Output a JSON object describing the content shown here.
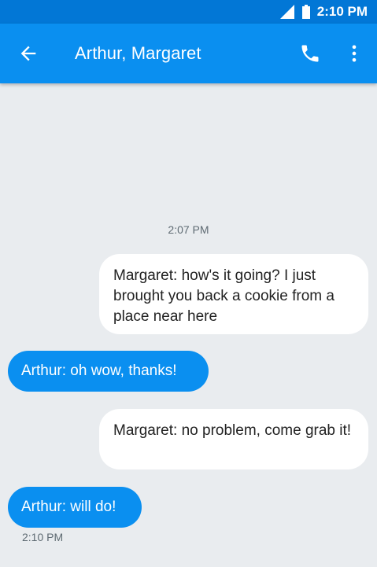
{
  "status_bar": {
    "time": "2:10 PM",
    "icons": [
      "signal-icon",
      "battery-icon"
    ]
  },
  "app_bar": {
    "title": "Arthur, Margaret",
    "icons": [
      "back-arrow-icon",
      "phone-icon",
      "more-vert-icon"
    ]
  },
  "conversation": {
    "start_timestamp": "2:07 PM",
    "messages": [
      {
        "direction": "outgoing",
        "text": "Margaret: how's it going? I just brought you back a cookie from a place near here"
      },
      {
        "direction": "incoming",
        "text": "Arthur: oh wow, thanks!"
      },
      {
        "direction": "outgoing",
        "text": "Margaret: no problem, come grab it!"
      },
      {
        "direction": "incoming",
        "text": "Arthur: will do!"
      }
    ],
    "last_timestamp": "2:10 PM"
  },
  "colors": {
    "status_bar": "#0277d6",
    "app_bar": "#0a8ff0",
    "background": "#e9ecef",
    "incoming_bubble": "#0a8ff0",
    "outgoing_bubble": "#ffffff"
  }
}
